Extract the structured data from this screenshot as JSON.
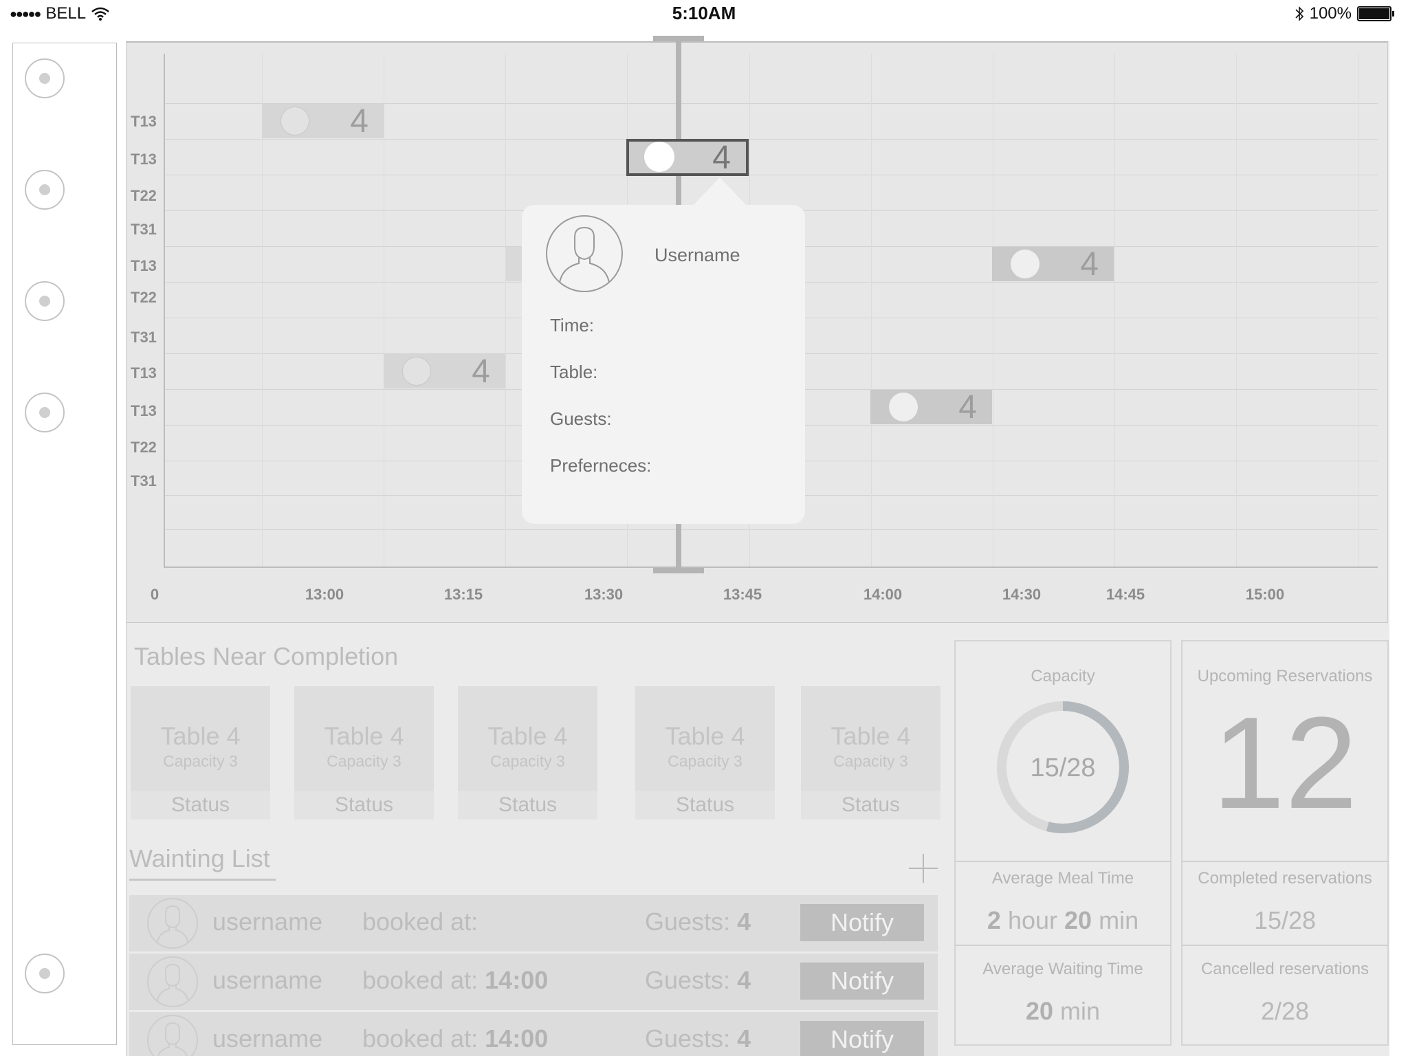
{
  "status_bar": {
    "carrier": "BELL",
    "time": "5:10AM",
    "battery": "100%"
  },
  "sidebar": {
    "buttons": [
      "nav-1",
      "nav-2",
      "nav-3",
      "nav-4",
      "nav-5"
    ]
  },
  "timeline": {
    "row_labels": [
      "T13",
      "T13",
      "T22",
      "T31",
      "T13",
      "T22",
      "T31",
      "T13",
      "T13",
      "T22",
      "T31"
    ],
    "x_ticks": [
      "0",
      "13:00",
      "13:15",
      "13:30",
      "13:45",
      "14:00",
      "14:30",
      "14:45",
      "15:00"
    ],
    "reservations": [
      {
        "guests": "4"
      },
      {
        "guests": "4"
      },
      {
        "guests": "4"
      },
      {
        "guests": "4"
      },
      {
        "guests": "4"
      }
    ]
  },
  "popover": {
    "username": "Username",
    "fields": [
      "Time:",
      "Table:",
      "Guests:",
      "Preferneces:"
    ]
  },
  "tables_near_completion": {
    "title": "Tables Near Completion",
    "cards": [
      {
        "name": "Table 4",
        "capacity": "Capacity 3",
        "status": "Status"
      },
      {
        "name": "Table 4",
        "capacity": "Capacity 3",
        "status": "Status"
      },
      {
        "name": "Table 4",
        "capacity": "Capacity 3",
        "status": "Status"
      },
      {
        "name": "Table 4",
        "capacity": "Capacity 3",
        "status": "Status"
      },
      {
        "name": "Table 4",
        "capacity": "Capacity 3",
        "status": "Status"
      }
    ]
  },
  "waiting_list": {
    "title": "Wainting List",
    "rows": [
      {
        "username": "username",
        "booked_label": "booked at:",
        "booked_time": "",
        "guests_label": "Guests:",
        "guests": "4",
        "action": "Notify"
      },
      {
        "username": "username",
        "booked_label": "booked at:",
        "booked_time": "14:00",
        "guests_label": "Guests:",
        "guests": "4",
        "action": "Notify"
      },
      {
        "username": "username",
        "booked_label": "booked at:",
        "booked_time": "14:00",
        "guests_label": "Guests:",
        "guests": "4",
        "action": "Notify"
      }
    ]
  },
  "stats": {
    "capacity": {
      "title": "Capacity",
      "value": "15/28",
      "fraction": 0.54
    },
    "upcoming": {
      "title": "Upcoming Reservations",
      "value": "12"
    },
    "avg_meal": {
      "title": "Average Meal Time",
      "hours": "2",
      "hour_unit": "hour",
      "minutes": "20",
      "min_unit": "min"
    },
    "completed": {
      "title": "Completed reservations",
      "value": "15/28"
    },
    "avg_wait": {
      "title": "Average Waiting Time",
      "minutes": "20",
      "min_unit": "min"
    },
    "cancelled": {
      "title": "Cancelled reservations",
      "value": "2/28"
    }
  }
}
